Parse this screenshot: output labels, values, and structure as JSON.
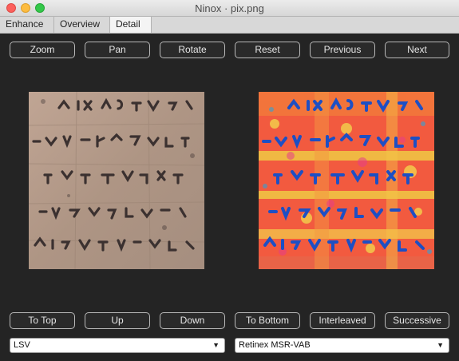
{
  "window": {
    "title": "Ninox · pix.png"
  },
  "tabs": [
    {
      "label": "Enhance",
      "active": false
    },
    {
      "label": "Overview",
      "active": false
    },
    {
      "label": "Detail",
      "active": true
    }
  ],
  "top_buttons": [
    "Zoom",
    "Pan",
    "Rotate",
    "Reset",
    "Previous",
    "Next"
  ],
  "bottom_buttons": [
    "To Top",
    "Up",
    "Down",
    "To Bottom",
    "Interleaved",
    "Successive"
  ],
  "left_select": {
    "value": "LSV"
  },
  "right_select": {
    "value": "Retinex MSR-VAB"
  },
  "images": {
    "left": {
      "description_icon": "papyrus-grayscale-image"
    },
    "right": {
      "description_icon": "papyrus-falsecolor-image"
    }
  },
  "colors": {
    "background": "#242424",
    "left_bg": "#b49a88",
    "left_ink": "#3a3130",
    "right_bg": "#f25a3f",
    "right_ink": "#1c4fc2",
    "right_highlight": "#f6d63c"
  }
}
